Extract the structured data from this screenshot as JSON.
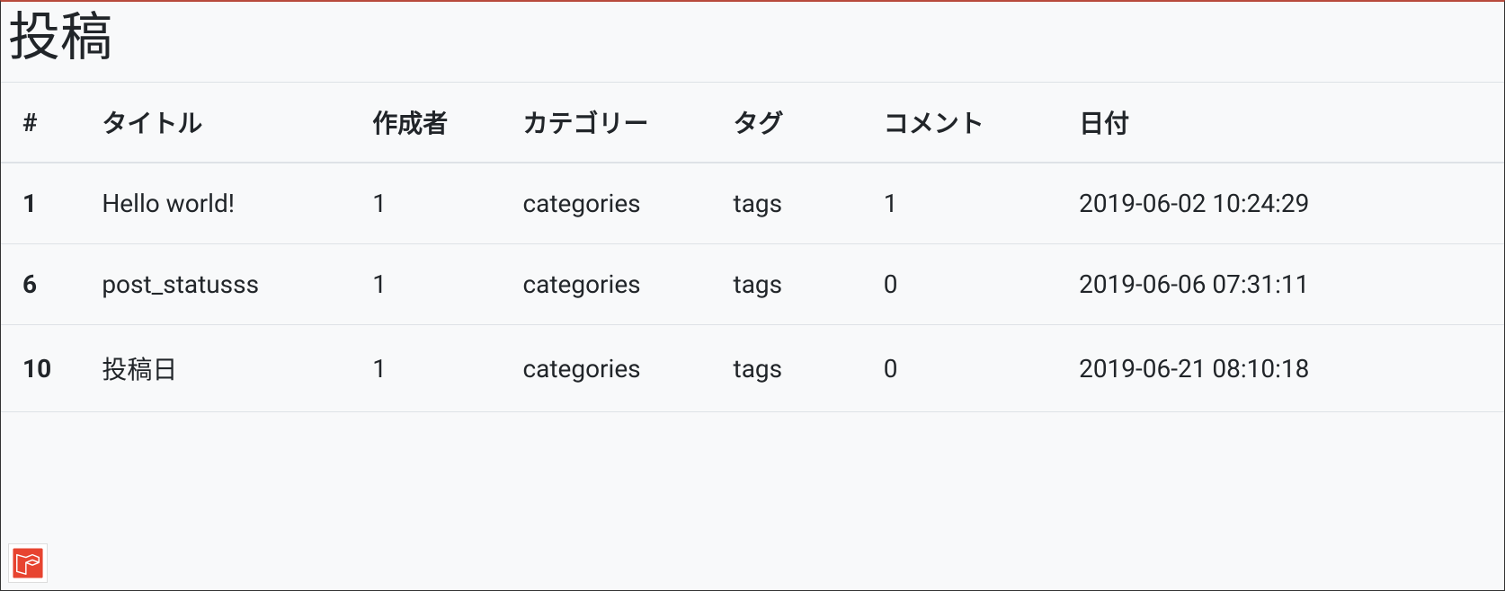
{
  "page": {
    "title": "投稿"
  },
  "table": {
    "headers": {
      "id": "#",
      "title": "タイトル",
      "author": "作成者",
      "category": "カテゴリー",
      "tag": "タグ",
      "comment": "コメント",
      "date": "日付"
    },
    "rows": [
      {
        "id": "1",
        "title": "Hello world!",
        "author": "1",
        "category": "categories",
        "tag": "tags",
        "comment": "1",
        "date": "2019-06-02 10:24:29"
      },
      {
        "id": "6",
        "title": "post_statusss",
        "author": "1",
        "category": "categories",
        "tag": "tags",
        "comment": "0",
        "date": "2019-06-06 07:31:11"
      },
      {
        "id": "10",
        "title": "投稿日",
        "author": "1",
        "category": "categories",
        "tag": "tags",
        "comment": "0",
        "date": "2019-06-21 08:10:18"
      }
    ]
  }
}
